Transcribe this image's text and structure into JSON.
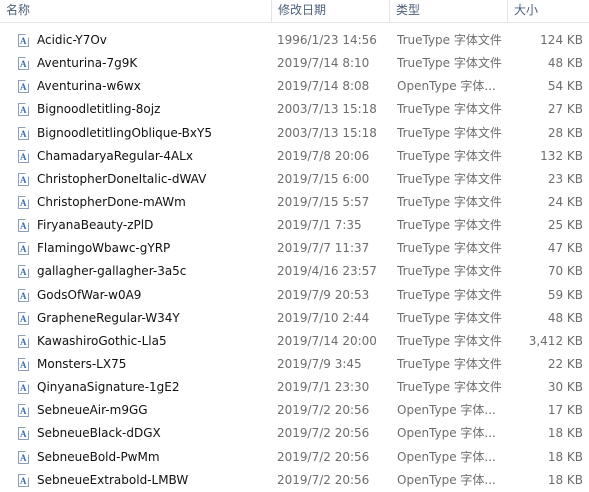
{
  "columns": {
    "name": "名称",
    "date": "修改日期",
    "type": "类型",
    "size": "大小"
  },
  "files": [
    {
      "name": "Acidic-Y7Ov",
      "date": "1996/1/23 14:56",
      "type": "TrueType 字体文件",
      "size": "124 KB",
      "icon": "font-file-icon"
    },
    {
      "name": "Aventurina-7g9K",
      "date": "2019/7/14 8:10",
      "type": "TrueType 字体文件",
      "size": "48 KB",
      "icon": "font-file-icon"
    },
    {
      "name": "Aventurina-w6wx",
      "date": "2019/7/14 8:08",
      "type": "OpenType 字体...",
      "size": "54 KB",
      "icon": "font-file-icon"
    },
    {
      "name": "Bignoodletitling-8ojz",
      "date": "2003/7/13 15:18",
      "type": "TrueType 字体文件",
      "size": "27 KB",
      "icon": "font-file-icon"
    },
    {
      "name": "BignoodletitlingOblique-BxY5",
      "date": "2003/7/13 15:18",
      "type": "TrueType 字体文件",
      "size": "28 KB",
      "icon": "font-file-icon"
    },
    {
      "name": "ChamadaryaRegular-4ALx",
      "date": "2019/7/8 20:06",
      "type": "TrueType 字体文件",
      "size": "132 KB",
      "icon": "font-file-icon"
    },
    {
      "name": "ChristopherDoneItalic-dWAV",
      "date": "2019/7/15 6:00",
      "type": "TrueType 字体文件",
      "size": "23 KB",
      "icon": "font-file-icon"
    },
    {
      "name": "ChristopherDone-mAWm",
      "date": "2019/7/15 5:57",
      "type": "TrueType 字体文件",
      "size": "24 KB",
      "icon": "font-file-icon"
    },
    {
      "name": "FiryanaBeauty-zPlD",
      "date": "2019/7/1 7:35",
      "type": "TrueType 字体文件",
      "size": "25 KB",
      "icon": "font-file-icon"
    },
    {
      "name": "FlamingoWbawc-gYRP",
      "date": "2019/7/7 11:37",
      "type": "TrueType 字体文件",
      "size": "47 KB",
      "icon": "font-file-icon"
    },
    {
      "name": "gallagher-gallagher-3a5c",
      "date": "2019/4/16 23:57",
      "type": "TrueType 字体文件",
      "size": "70 KB",
      "icon": "font-file-icon"
    },
    {
      "name": "GodsOfWar-w0A9",
      "date": "2019/7/9 20:53",
      "type": "TrueType 字体文件",
      "size": "59 KB",
      "icon": "font-file-icon"
    },
    {
      "name": "GrapheneRegular-W34Y",
      "date": "2019/7/10 2:44",
      "type": "TrueType 字体文件",
      "size": "48 KB",
      "icon": "font-file-icon"
    },
    {
      "name": "KawashiroGothic-Lla5",
      "date": "2019/7/14 20:00",
      "type": "TrueType 字体文件",
      "size": "3,412 KB",
      "icon": "font-file-icon"
    },
    {
      "name": "Monsters-LX75",
      "date": "2019/7/9 3:45",
      "type": "TrueType 字体文件",
      "size": "22 KB",
      "icon": "font-file-icon"
    },
    {
      "name": "QinyanaSignature-1gE2",
      "date": "2019/7/1 23:30",
      "type": "TrueType 字体文件",
      "size": "30 KB",
      "icon": "font-file-icon"
    },
    {
      "name": "SebneueAir-m9GG",
      "date": "2019/7/2 20:56",
      "type": "OpenType 字体...",
      "size": "17 KB",
      "icon": "font-file-icon"
    },
    {
      "name": "SebneueBlack-dDGX",
      "date": "2019/7/2 20:56",
      "type": "OpenType 字体...",
      "size": "18 KB",
      "icon": "font-file-icon"
    },
    {
      "name": "SebneueBold-PwMm",
      "date": "2019/7/2 20:56",
      "type": "OpenType 字体...",
      "size": "18 KB",
      "icon": "font-file-icon"
    },
    {
      "name": "SebneueExtrabold-LMBW",
      "date": "2019/7/2 20:56",
      "type": "OpenType 字体...",
      "size": "18 KB",
      "icon": "font-file-icon"
    }
  ]
}
